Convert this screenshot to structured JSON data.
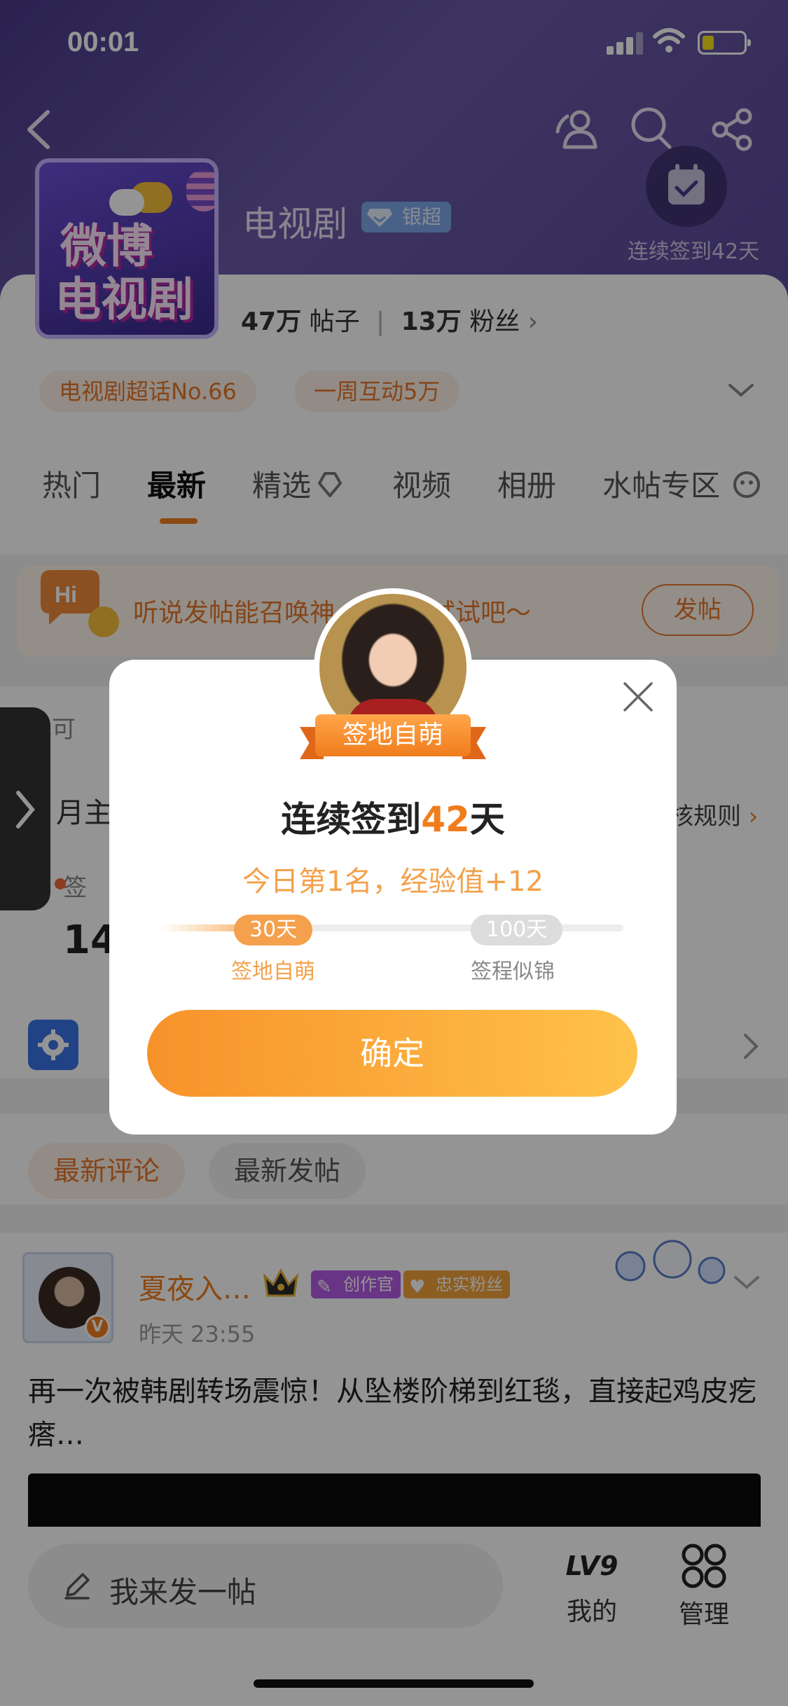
{
  "status_bar": {
    "time": "00:01"
  },
  "header": {
    "topic_name": "电视剧",
    "level_badge": "银超",
    "logo_line1": "微博",
    "logo_line2": "电视剧",
    "checkin_text": "连续签到42天"
  },
  "stats": {
    "posts_value": "47万",
    "posts_label": "帖子",
    "fans_value": "13万",
    "fans_label": "粉丝"
  },
  "chips": [
    "电视剧超话No.66",
    "一周互动5万"
  ],
  "tabs": [
    "热门",
    "最新",
    "精选",
    "视频",
    "相册",
    "水帖专区"
  ],
  "active_tab": "最新",
  "hint": {
    "text": "听说发帖能召唤神",
    "text_tail": "来试试吧～",
    "button": "发帖"
  },
  "behind": {
    "frag1": "己可",
    "frag2": "月主",
    "frag3": "签",
    "frag4": "14",
    "rules": "核规则"
  },
  "comment_tabs": [
    "最新评论",
    "最新发帖"
  ],
  "post": {
    "username": "夏夜入…",
    "badge_creator": "创作官",
    "badge_fan": "忠实粉丝",
    "time": "昨天 23:55",
    "text": "再一次被韩剧转场震惊！从坠楼阶梯到红毯，直接起鸡皮疙瘩…"
  },
  "bottom_bar": {
    "compose": "我来发一帖",
    "me_level": "LV9",
    "me_label": "我的",
    "admin_label": "管理"
  },
  "modal": {
    "title_prefix": "连续签到",
    "title_number": "42",
    "title_suffix": "天",
    "ribbon": "签地自萌",
    "subtitle": "今日第1名，经验值+12",
    "milestone1_badge": "30天",
    "milestone1_label": "签地自萌",
    "milestone2_badge": "100天",
    "milestone2_label": "签程似锦",
    "progress_fraction": 0.25,
    "confirm": "确定"
  },
  "colors": {
    "accent": "#f07c1c",
    "header_bg": "#5b4a9a",
    "button_start": "#f7922a",
    "button_end": "#ffc24b"
  }
}
